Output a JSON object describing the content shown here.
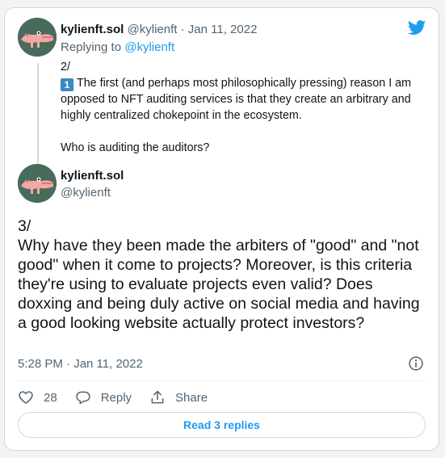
{
  "quoted_tweet": {
    "display_name": "kylienft.sol",
    "handle": "@kylienft",
    "separator": "·",
    "date": "Jan 11, 2022",
    "replying_prefix": "Replying to",
    "replying_handle": "@kylienft",
    "line_number": "2/",
    "keycap": "1",
    "text_main": "The first (and perhaps most philosophically pressing) reason I am opposed to NFT auditing services is that they create an arbitrary and highly centralized chokepoint in the ecosystem.",
    "text_question": "Who is auditing the auditors?"
  },
  "main_tweet": {
    "display_name": "kylienft.sol",
    "handle": "@kylienft",
    "line_number": "3/",
    "text": "Why have they been made the arbiters of \"good\" and \"not good\" when it come to projects? Moreover, is this criteria they're using to evaluate projects even valid? Does doxxing and being duly active on social media and having a good looking website actually protect investors?",
    "timestamp": "5:28 PM · Jan 11, 2022"
  },
  "actions": {
    "like_count": "28",
    "reply_label": "Reply",
    "share_label": "Share"
  },
  "read_replies_label": "Read 3 replies",
  "icons": {
    "brand": "twitter-bird-icon",
    "info": "info-icon",
    "like": "heart-icon",
    "reply": "reply-bubble-icon",
    "share": "share-icon"
  },
  "colors": {
    "accent": "#1d9bf0",
    "avatar_bg": "#496b5c",
    "muted": "#536471",
    "border": "#cfd9de"
  }
}
